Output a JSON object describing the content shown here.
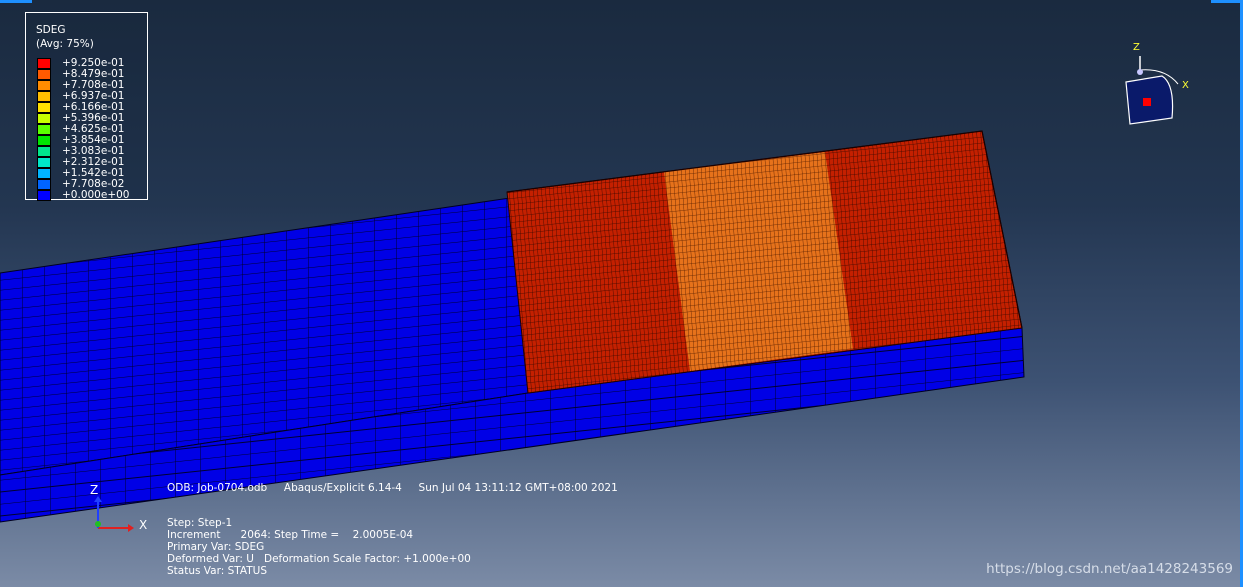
{
  "theme": {
    "frame_accent": "#1e90ff",
    "legend_colors": [
      "#ff0000",
      "#ff5a00",
      "#ff8c00",
      "#ffbe00",
      "#ffe100",
      "#c8ff00",
      "#5aff00",
      "#00e600",
      "#00e68c",
      "#00e6c8",
      "#00b4ff",
      "#0064ff",
      "#0000ff"
    ]
  },
  "legend": {
    "title": "SDEG",
    "subtitle": "(Avg: 75%)",
    "values": [
      "+9.250e-01",
      "+8.479e-01",
      "+7.708e-01",
      "+6.937e-01",
      "+6.166e-01",
      "+5.396e-01",
      "+4.625e-01",
      "+3.854e-01",
      "+3.083e-01",
      "+2.312e-01",
      "+1.542e-01",
      "+7.708e-02",
      "+0.000e+00"
    ]
  },
  "triad_top": {
    "z": "Z",
    "x": "X"
  },
  "triad_bottom": {
    "z": "Z",
    "x": "X"
  },
  "info": {
    "odb_line": "ODB: Job-0704.odb     Abaqus/Explicit 6.14-4     Sun Jul 04 13:11:12 GMT+08:00 2021",
    "step": "Step: Step-1",
    "increment": "Increment      2064: Step Time =    2.0005E-04",
    "primary": "Primary Var: SDEG",
    "deformed": "Deformed Var: U   Deformation Scale Factor: +1.000e+00",
    "status": "Status Var: STATUS"
  },
  "watermark": "https://blog.csdn.net/aa1428243569"
}
